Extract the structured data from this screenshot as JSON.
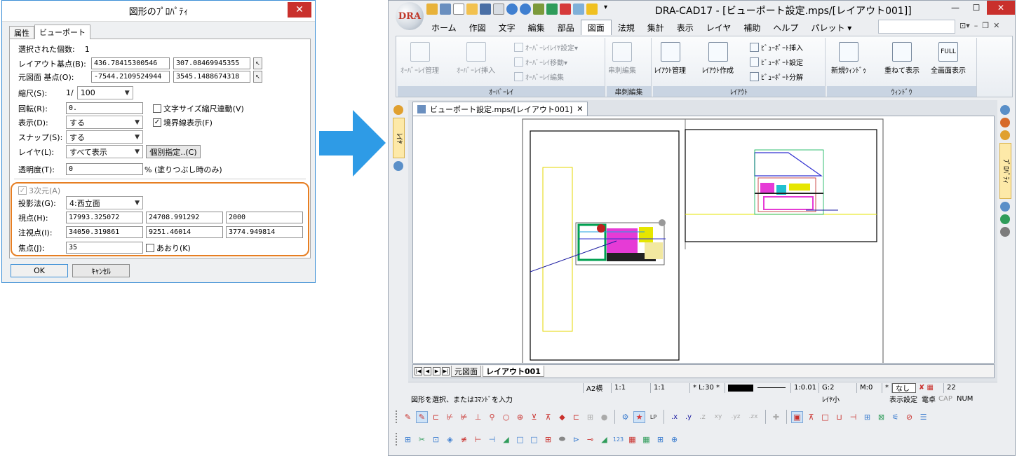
{
  "dialog": {
    "title": "図形のﾌﾟﾛﾊﾟﾃｨ",
    "tabs": [
      "属性",
      "ビューポート"
    ],
    "selected_count_label": "選択された個数:",
    "selected_count": "1",
    "layout_base_label": "レイアウト基点(B):",
    "layout_base_x": "436.78415300546",
    "layout_base_y": "307.08469945355",
    "orig_base_label": "元図面 基点(O):",
    "orig_base_x": "-7544.2109524944",
    "orig_base_y": "3545.1488674318",
    "scale_label": "縮尺(S):",
    "scale_prefix": "1/",
    "scale_value": "100",
    "rotate_label": "回転(R):",
    "rotate_value": "0.",
    "text_scale_link": "文字サイズ縮尺連動(V)",
    "display_label": "表示(D):",
    "display_value": "する",
    "border_display": "境界線表示(F)",
    "snap_label": "スナップ(S):",
    "snap_value": "する",
    "layer_label": "レイヤ(L):",
    "layer_value": "すべて表示",
    "individual_button": "個別指定..(C)",
    "opacity_label": "透明度(T):",
    "opacity_value": "0",
    "opacity_note": "% (塗りつぶし時のみ)",
    "three_d_label": "3次元(A)",
    "projection_label": "投影法(G):",
    "projection_value": "4:西立面",
    "viewpoint_label": "視点(H):",
    "viewpoint": [
      "17993.325072",
      "24708.991292",
      "2000"
    ],
    "target_label": "注視点(I):",
    "target": [
      "34050.319861",
      "9251.46014",
      "3774.949814"
    ],
    "focus_label": "焦点(J):",
    "focus_value": "35",
    "tilt_label": "あおり(K)",
    "ok": "OK",
    "cancel": "ｷｬﾝｾﾙ"
  },
  "cad": {
    "title": "DRA-CAD17 - [ビューポート設定.mps/[レイアウト001]]",
    "logo": "DRA",
    "menus": [
      "ホーム",
      "作図",
      "文字",
      "編集",
      "部品",
      "図面",
      "法規",
      "集計",
      "表示",
      "レイヤ",
      "補助",
      "ヘルプ",
      "パレット ▾"
    ],
    "active_menu": "図面",
    "ribbon": {
      "overlay_group": "ｵｰﾊﾞｰﾚｲ",
      "overlay_manage": "ｵｰﾊﾞｰﾚｲ管理",
      "overlay_insert": "ｵｰﾊﾞｰﾚｲ挿入",
      "overlay_layer": "ｵｰﾊﾞｰﾚｲﾚｲﾔ設定▾",
      "overlay_move": "ｵｰﾊﾞｰﾚｲ移動▾",
      "overlay_edit": "ｵｰﾊﾞｰﾚｲ編集",
      "kushi_group": "串刺編集",
      "kushi_button": "串刺編集",
      "layout_group": "ﾚｲｱｳﾄ",
      "layout_manage": "ﾚｲｱｳﾄ管理",
      "layout_create": "ﾚｲｱｳﾄ作成",
      "vp_insert": "ﾋﾞｭｰﾎﾟｰﾄ挿入",
      "vp_setting": "ﾋﾞｭｰﾎﾟｰﾄ設定",
      "vp_split": "ﾋﾞｭｰﾎﾟｰﾄ分解",
      "window_group": "ｳｨﾝﾄﾞｳ",
      "new_window": "新規ｳｨﾝﾄﾞｩ",
      "cascade": "重ねて表示",
      "fullscreen": "全画面表示"
    },
    "doc_tab": "ビューポート設定.mps/[レイアウト001]",
    "side_left_tab": "ﾚｲﾔ",
    "side_right_tab": "ﾌﾟﾛﾊﾟﾃｨ",
    "sheet_tabs": [
      "元図面",
      "レイアウト001"
    ],
    "status1": [
      "A2横",
      "1:1",
      "1:1",
      "* L:30 *",
      "1:0.01",
      "G:2",
      "M:0",
      "*",
      "なし",
      "22"
    ],
    "status2_msg": "図形を選択、またはｺﾏﾝﾄﾞを入力",
    "status2_right": [
      "ﾚｲﾔ小",
      "表示設定",
      "電卓",
      "CAP",
      "NUM"
    ]
  },
  "colors": {
    "accent_orange": "#e67e22",
    "arrow_blue": "#2e9be6",
    "close_red": "#c9302c"
  }
}
